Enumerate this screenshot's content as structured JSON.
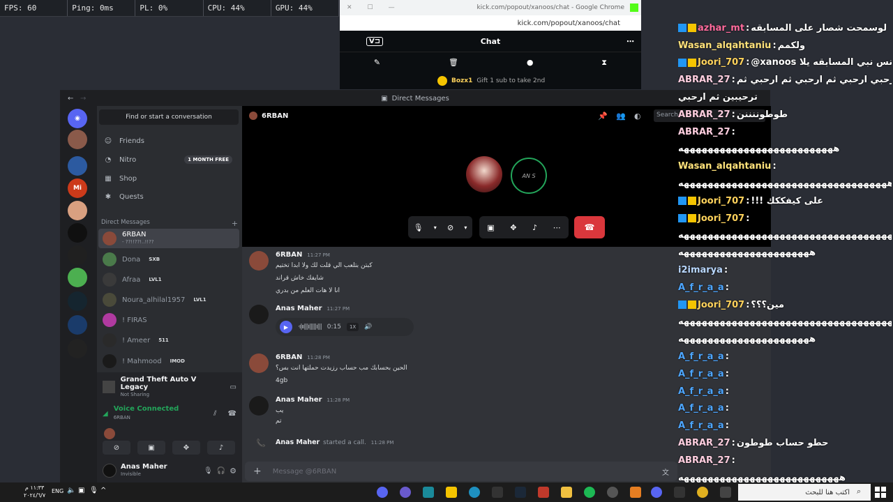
{
  "perf": {
    "fps": "FPS: 60",
    "ping": "Ping: 0ms",
    "pl": "PL: 0%",
    "cpu": "CPU: 44%",
    "gpu": "GPU: 44%"
  },
  "chrome": {
    "title": "kick.com/popout/xanoos/chat - Google Chrome",
    "url": "kick.com/popout/xanoos/chat",
    "chat_header": "Chat",
    "gift_user": "Bozx1",
    "gift_text": "Gift 1 sub to take 2nd"
  },
  "discord": {
    "title": "Direct Messages",
    "find": "Find or start a conversation",
    "nav": [
      {
        "label": "Friends",
        "icon": "friends-icon"
      },
      {
        "label": "Nitro",
        "icon": "nitro-icon",
        "badge": "1 MONTH FREE"
      },
      {
        "label": "Shop",
        "icon": "shop-icon"
      },
      {
        "label": "Quests",
        "icon": "quests-icon"
      }
    ],
    "dm_header": "Direct Messages",
    "dms": [
      {
        "name": "6RBAN",
        "sub": "- ??!!??!..!!??",
        "tag": ""
      },
      {
        "name": "Dona",
        "sub": "",
        "tag": "SXB"
      },
      {
        "name": "Afraa",
        "sub": "",
        "tag": "LVL1"
      },
      {
        "name": "Noura_alhilal1957",
        "sub": "",
        "tag": "LVL1"
      },
      {
        "name": "! FIRAS",
        "sub": "",
        "tag": ""
      },
      {
        "name": "! Ameer",
        "sub": "",
        "tag": "511"
      },
      {
        "name": "! Mahmood",
        "sub": "",
        "tag": "IMOD"
      }
    ],
    "activity": {
      "game": "Grand Theft Auto V Legacy",
      "status": "Not Sharing"
    },
    "voice": {
      "status": "Voice Connected",
      "channel": "6RBAN"
    },
    "user": {
      "name": "Anas Maher",
      "status": "Invisible"
    },
    "channel_name": "6RBAN",
    "search_placeholder": "Search",
    "call_avatar_text": "AN S",
    "messages": [
      {
        "author": "6RBAN",
        "time": "11:27 PM",
        "lines": [
          "كبتن بتلعب الي قلت لك ولا ابدا تختيم",
          "شايفك خاش قراند",
          "انا لا هات العلم من بدري"
        ]
      },
      {
        "author": "Anas Maher",
        "time": "11:27 PM",
        "voice": "0:15",
        "speed": "1X"
      },
      {
        "author": "6RBAN",
        "time": "11:28 PM",
        "lines": [
          "الحين بحسابك مب حساب رزيدت حملتها انت بس؟",
          "4gb"
        ]
      },
      {
        "author": "Anas Maher",
        "time": "11:28 PM",
        "lines": [
          "يب",
          "تم"
        ]
      }
    ],
    "call_started": {
      "author": "Anas Maher",
      "text": "started a call.",
      "time": "11:28 PM"
    },
    "composer_placeholder": "Message @6RBAN"
  },
  "kick_chat": [
    {
      "user": "",
      "msg": "",
      "color": "#ffffff"
    },
    {
      "user": "azhar_mt",
      "msg": "لوسمحت شصار على المسابقه",
      "color": "#ff6b9d",
      "badges": 2
    },
    {
      "user": "Wasan_alqahtaniu",
      "msg": "ولكمم",
      "color": "#ffe27a",
      "badges": 0
    },
    {
      "user": "Joori_707",
      "msg": "@xanoos انس نبي المسابقه يلا",
      "color": "#ffd35c",
      "badges": 2
    },
    {
      "user": "ABRAR_27",
      "msg": "ولكم ارحبي ارحبي ارحبي ثم ارحبي ثم ارحبي ثم",
      "color": "#ffcfe0",
      "badges": 0
    },
    {
      "user": "",
      "msg": "ترحيبين ثم ارحبي",
      "color": "#ffffff",
      "badges": 0
    },
    {
      "user": "ABRAR_27",
      "msg": "طوطوننننن",
      "color": "#ffcfe0",
      "badges": 0
    },
    {
      "user": "ABRAR_27",
      "msg": "",
      "color": "#ffcfe0",
      "badges": 0
    },
    {
      "user": "",
      "msg": "ههههههههههههههههههههههههههه",
      "color": "#ffffff",
      "badges": 0
    },
    {
      "user": "Wasan_alqahtaniu",
      "msg": "",
      "color": "#ffe27a",
      "badges": 0
    },
    {
      "user": "",
      "msg": "هههههههههههههههههههههههههههههههههههه",
      "color": "#ffffff",
      "badges": 0
    },
    {
      "user": "Joori_707",
      "msg": "على كيفككك !!!",
      "color": "#ffd35c",
      "badges": 2
    },
    {
      "user": "Joori_707",
      "msg": "",
      "color": "#ffd35c",
      "badges": 2
    },
    {
      "user": "",
      "msg": "هههههههههههههههههههههههههههههههههههههه",
      "color": "#ffffff",
      "badges": 0
    },
    {
      "user": "",
      "msg": "ههههههههههههههههههههههه",
      "color": "#ffffff",
      "badges": 0
    },
    {
      "user": "i2imarya",
      "msg": "",
      "color": "#b9d8ff",
      "badges": 0
    },
    {
      "user": "A_f_r_a_a",
      "msg": "",
      "color": "#4da6ff",
      "badges": 0
    },
    {
      "user": "Joori_707",
      "msg": "مين؟؟؟",
      "color": "#ffd35c",
      "badges": 2
    },
    {
      "user": "",
      "msg": "هههههههههههههههههههههههههههههههههههههه",
      "color": "#ffffff",
      "badges": 0
    },
    {
      "user": "",
      "msg": "ههههههههههههههههههههههه",
      "color": "#ffffff",
      "badges": 0
    },
    {
      "user": "A_f_r_a_a",
      "msg": "",
      "color": "#4da6ff",
      "badges": 0
    },
    {
      "user": "A_f_r_a_a",
      "msg": "",
      "color": "#4da6ff",
      "badges": 0
    },
    {
      "user": "A_f_r_a_a",
      "msg": "",
      "color": "#4da6ff",
      "badges": 0
    },
    {
      "user": "A_f_r_a_a",
      "msg": "",
      "color": "#4da6ff",
      "badges": 0
    },
    {
      "user": "A_f_r_a_a",
      "msg": "",
      "color": "#4da6ff",
      "badges": 0
    },
    {
      "user": "ABRAR_27",
      "msg": "حطو حساب طوطون",
      "color": "#ffcfe0",
      "badges": 0
    },
    {
      "user": "ABRAR_27",
      "msg": "",
      "color": "#ffcfe0",
      "badges": 0
    },
    {
      "user": "",
      "msg": "هههههههههههههههههههههههههههه",
      "color": "#ffffff",
      "badges": 0
    }
  ],
  "taskbar": {
    "time": "١١:٣٣ م",
    "date": "٢٠٢٤/٦/٧",
    "lang": "ENG",
    "search_placeholder": "اكتب هنا للبحث"
  },
  "colors": {
    "discord_blurple": "#5865f2",
    "end_call_red": "#da373c",
    "voice_green": "#23a55a"
  }
}
